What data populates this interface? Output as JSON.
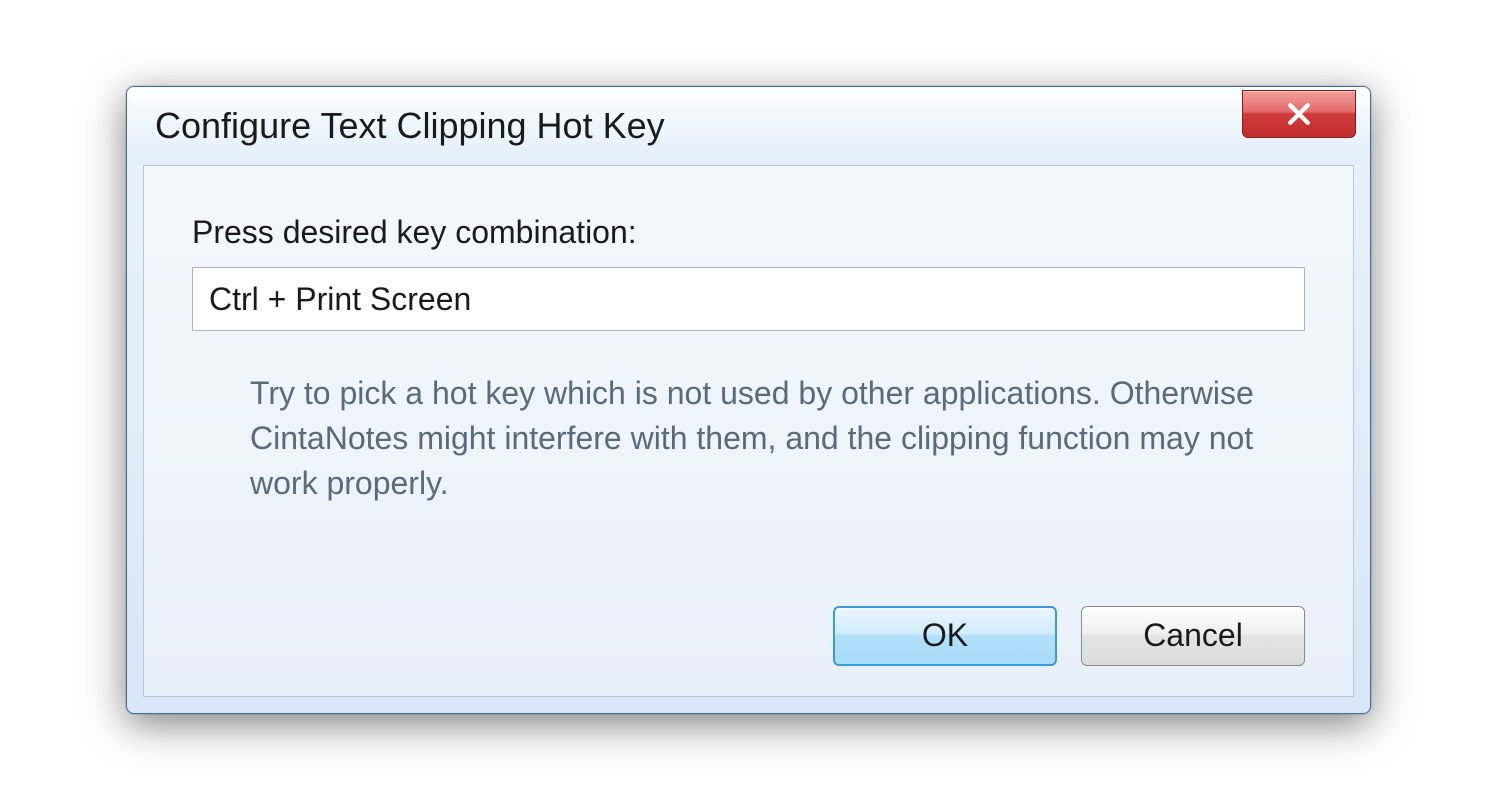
{
  "dialog": {
    "title": "Configure Text Clipping Hot Key",
    "field_label": "Press desired key combination:",
    "hotkey_value": "Ctrl + Print Screen",
    "hint": "Try to pick a hot key which is not used by other applications. Otherwise CintaNotes might interfere with them, and the clipping function may not work properly.",
    "ok_label": "OK",
    "cancel_label": "Cancel"
  }
}
